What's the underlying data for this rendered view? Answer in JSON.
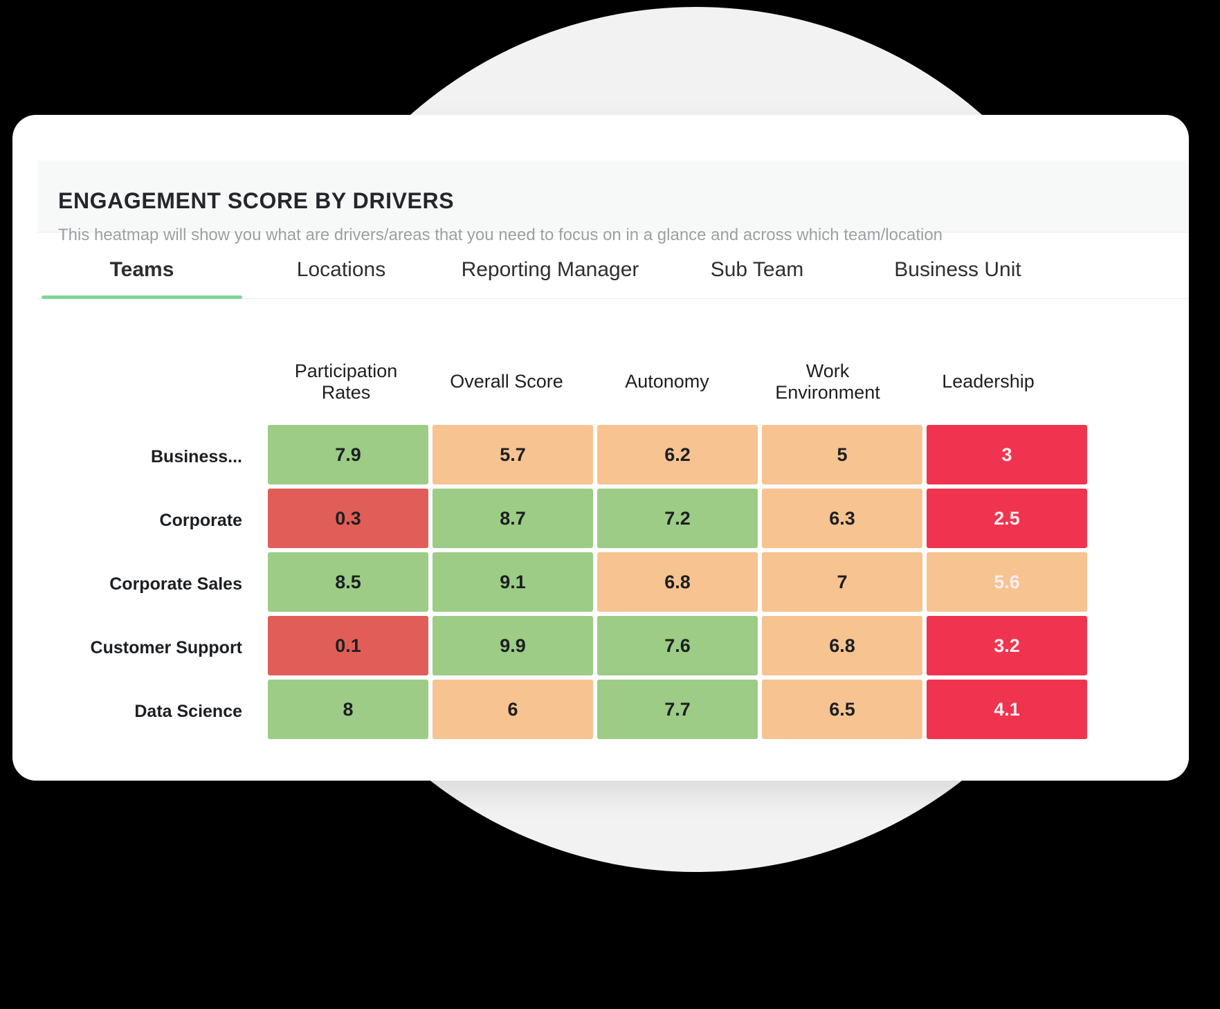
{
  "header": {
    "title": "ENGAGEMENT SCORE BY DRIVERS",
    "subtitle": "This heatmap will show you what are drivers/areas that you need to focus on in a glance and across which team/location"
  },
  "tabs": [
    {
      "label": "Teams",
      "active": true
    },
    {
      "label": "Locations",
      "active": false
    },
    {
      "label": "Reporting Manager",
      "active": false
    },
    {
      "label": "Sub Team",
      "active": false
    },
    {
      "label": "Business Unit",
      "active": false
    }
  ],
  "colors": {
    "green": "#9ccc86",
    "orange": "#f7c391",
    "red": "#e05e57",
    "crimson": "#f0344f",
    "accent_underline": "#7fd49a",
    "header_bg": "#f7f8f8",
    "backdrop": "#f2f2f2"
  },
  "chart_data": {
    "type": "heatmap",
    "title": "ENGAGEMENT SCORE BY DRIVERS",
    "subtitle": "This heatmap will show you what are drivers/areas that you need to focus on in a glance and across which team/location",
    "xlabel": "",
    "ylabel": "",
    "row_axis": "Teams",
    "columns": [
      "Participation Rates",
      "Overall Score",
      "Autonomy",
      "Work Environment",
      "Leadership"
    ],
    "rows": [
      "Business...",
      "Corporate",
      "Corporate Sales",
      "Customer Support",
      "Data Science"
    ],
    "values": [
      [
        7.9,
        5.7,
        6.2,
        5,
        3
      ],
      [
        0.3,
        8.7,
        7.2,
        6.3,
        2.5
      ],
      [
        8.5,
        9.1,
        6.8,
        7,
        5.6
      ],
      [
        0.1,
        9.9,
        7.6,
        6.8,
        3.2
      ],
      [
        8,
        6,
        7.7,
        6.5,
        4.1
      ]
    ],
    "cell_labels": [
      [
        "7.9",
        "5.7",
        "6.2",
        "5",
        "3"
      ],
      [
        "0.3",
        "8.7",
        "7.2",
        "6.3",
        "2.5"
      ],
      [
        "8.5",
        "9.1",
        "6.8",
        "7",
        "5.6"
      ],
      [
        "0.1",
        "9.9",
        "7.6",
        "6.8",
        "3.2"
      ],
      [
        "8",
        "6",
        "7.7",
        "6.5",
        "4.1"
      ]
    ],
    "cell_colors": [
      [
        "#9ccc86",
        "#f7c391",
        "#f7c391",
        "#f7c391",
        "#f0344f"
      ],
      [
        "#e05e57",
        "#9ccc86",
        "#9ccc86",
        "#f7c391",
        "#f0344f"
      ],
      [
        "#9ccc86",
        "#9ccc86",
        "#f7c391",
        "#f7c391",
        "#f7c391"
      ],
      [
        "#e05e57",
        "#9ccc86",
        "#9ccc86",
        "#f7c391",
        "#f0344f"
      ],
      [
        "#9ccc86",
        "#f7c391",
        "#9ccc86",
        "#f7c391",
        "#f0344f"
      ]
    ],
    "cell_text_light": [
      [
        false,
        false,
        false,
        false,
        true
      ],
      [
        false,
        false,
        false,
        false,
        true
      ],
      [
        false,
        false,
        false,
        false,
        true
      ],
      [
        false,
        false,
        false,
        false,
        true
      ],
      [
        false,
        false,
        false,
        false,
        true
      ]
    ],
    "legend": [],
    "grid": false
  }
}
